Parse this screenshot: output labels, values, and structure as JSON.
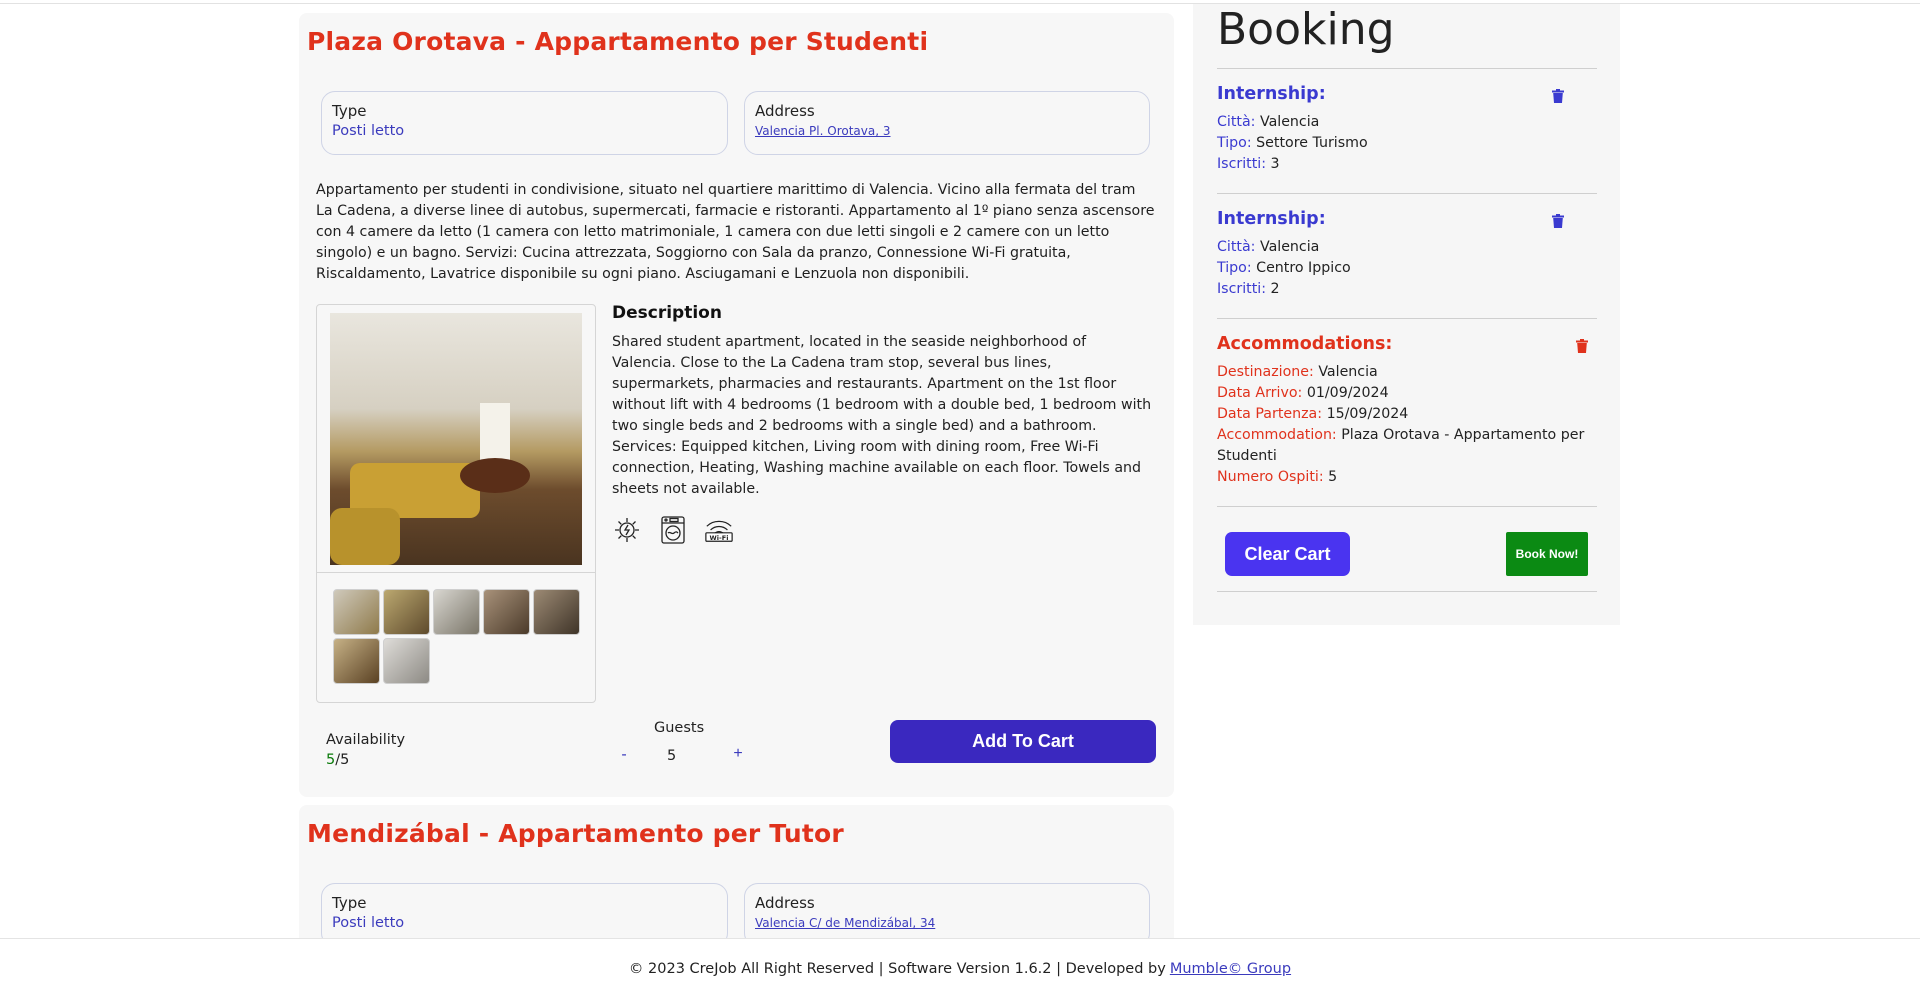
{
  "listings": [
    {
      "title": "Plaza Orotava - Appartamento per Studenti",
      "type_label": "Type",
      "type_value": "Posti letto",
      "address_label": "Address",
      "address_value": "Valencia Pl. Orotava, 3",
      "description_it": "Appartamento per studenti in condivisione, situato nel quartiere marittimo di Valencia. Vicino alla fermata del tram La Cadena, a diverse linee di autobus, supermercati, farmacie e ristoranti. Appartamento al 1º piano senza ascensore con 4 camere da letto (1 camera con letto matrimoniale, 1 camera con due letti singoli e 2 camere con un letto singolo) e un bagno. Servizi: Cucina attrezzata, Soggiorno con Sala da pranzo, Connessione Wi-Fi gratuita, Riscaldamento, Lavatrice disponibile su ogni piano. Asciugamani e Lenzuola non disponibili.",
      "description_title": "Description",
      "description_en": "Shared student apartment, located in the seaside neighborhood of Valencia. Close to the La Cadena tram stop, several bus lines, supermarkets, pharmacies and restaurants. Apartment on the 1st floor without lift with 4 bedrooms (1 bedroom with a double bed, 1 bedroom with two single beds and 2 bedrooms with a single bed) and a bathroom. Services: Equipped kitchen, Living room with dining room, Free Wi-Fi connection, Heating, Washing machine available on each floor. Towels and sheets not available.",
      "amenity_icons": [
        "heating-icon",
        "washing-machine-icon",
        "wifi-icon"
      ],
      "wifi_text": "Wi-Fi",
      "availability_label": "Availability",
      "availability_available": "5",
      "availability_total": "/5",
      "guests_label": "Guests",
      "guests_minus": "-",
      "guests_value": "5",
      "guests_plus": "+",
      "add_to_cart": "Add To Cart"
    },
    {
      "title": "Mendizábal - Appartamento per Tutor",
      "type_label": "Type",
      "type_value": "Posti letto",
      "address_label": "Address",
      "address_value": "Valencia C/ de Mendizábal, 34"
    }
  ],
  "booking": {
    "title": "Booking",
    "internship_1": {
      "heading": "Internship:",
      "city_key": "Città:",
      "city_value": "Valencia",
      "type_key": "Tipo:",
      "type_value": "Settore Turismo",
      "enrolled_key": "Iscritti:",
      "enrolled_value": "3"
    },
    "internship_2": {
      "heading": "Internship:",
      "city_key": "Città:",
      "city_value": "Valencia",
      "type_key": "Tipo:",
      "type_value": "Centro Ippico",
      "enrolled_key": "Iscritti:",
      "enrolled_value": "2"
    },
    "accommodation": {
      "heading": "Accommodations:",
      "dest_key": "Destinazione:",
      "dest_value": "Valencia",
      "arrival_key": "Data Arrivo:",
      "arrival_value": "01/09/2024",
      "departure_key": "Data Partenza:",
      "departure_value": "15/09/2024",
      "acc_key": "Accommodation:",
      "acc_value": "Plaza Orotava - Appartamento per Studenti",
      "guests_key": "Numero Ospiti:",
      "guests_value": "5"
    },
    "clear_cart": "Clear Cart",
    "book_now": "Book Now!"
  },
  "footer": {
    "text": "© 2023 CreJob All Right Reserved | Software Version 1.6.2 | Developed by",
    "link": "Mumble© Group"
  },
  "colors": {
    "title_red": "#e0321c",
    "accent_blue": "#3a3ad0",
    "add_cart_bg": "#3a28bf",
    "clear_cart_bg": "#4a34f0",
    "book_now_bg": "#0b8a13"
  }
}
